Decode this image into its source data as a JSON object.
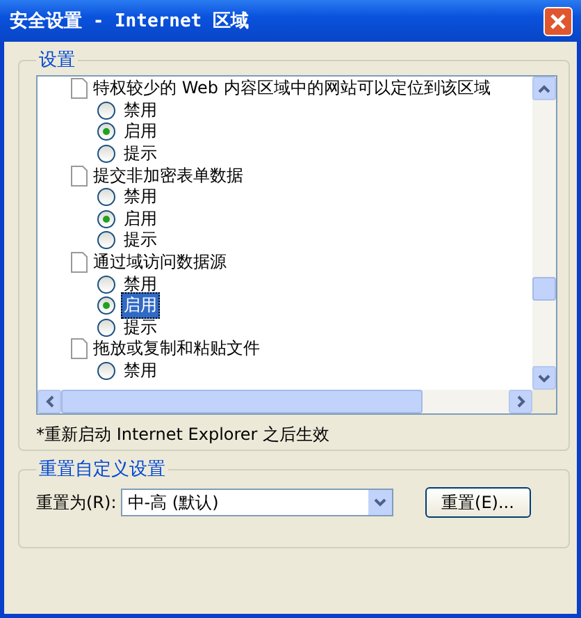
{
  "window": {
    "title": "安全设置 - Internet 区域"
  },
  "settings_group": {
    "label": "设置",
    "items": [
      {
        "label": "特权较少的 Web 内容区域中的网站可以定位到该区域",
        "options": [
          {
            "label": "禁用",
            "selected": false,
            "focused": false
          },
          {
            "label": "启用",
            "selected": true,
            "focused": false
          },
          {
            "label": "提示",
            "selected": false,
            "focused": false
          }
        ]
      },
      {
        "label": "提交非加密表单数据",
        "options": [
          {
            "label": "禁用",
            "selected": false,
            "focused": false
          },
          {
            "label": "启用",
            "selected": true,
            "focused": false
          },
          {
            "label": "提示",
            "selected": false,
            "focused": false
          }
        ]
      },
      {
        "label": "通过域访问数据源",
        "options": [
          {
            "label": "禁用",
            "selected": false,
            "focused": false
          },
          {
            "label": "启用",
            "selected": true,
            "focused": true
          },
          {
            "label": "提示",
            "selected": false,
            "focused": false
          }
        ]
      },
      {
        "label": "拖放或复制和粘贴文件",
        "options": [
          {
            "label": "禁用",
            "selected": false,
            "focused": false
          }
        ]
      }
    ],
    "note": "*重新启动 Internet Explorer 之后生效"
  },
  "reset_group": {
    "label": "重置自定义设置",
    "field_label": "重置为(R):",
    "value": "中-高 (默认)",
    "button": "重置(E)..."
  }
}
